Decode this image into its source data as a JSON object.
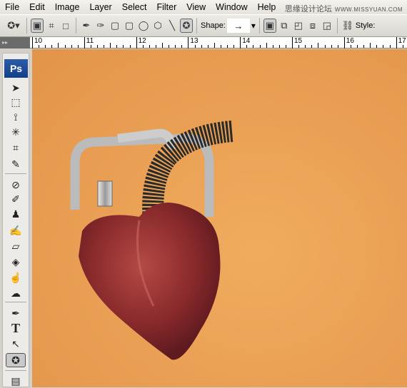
{
  "menubar": {
    "items": [
      "File",
      "Edit",
      "Image",
      "Layer",
      "Select",
      "Filter",
      "View",
      "Window",
      "Help"
    ],
    "watermark": "思缘设计论坛",
    "watermark_url": "WWW.MISSYUAN.COM"
  },
  "options": {
    "shape_label": "Shape:",
    "style_label": "Style:",
    "shape_value": "→"
  },
  "ruler": {
    "labels": [
      "10",
      "11",
      "12",
      "13",
      "14",
      "15",
      "16",
      "17"
    ]
  },
  "toolbox": {
    "logo": "Ps",
    "tools": [
      "move",
      "rectangular-marquee",
      "polygonal-lasso",
      "magic-wand",
      "crop",
      "slice",
      "healing-brush",
      "brush",
      "clone-stamp",
      "history-brush",
      "eraser",
      "paint-bucket",
      "dodge",
      "smudge",
      "pen",
      "type",
      "path-selection",
      "custom-shape",
      "notes"
    ],
    "type_glyph": "T",
    "selected": "custom-shape"
  },
  "colors": {
    "canvas": "#e89d52",
    "accent": "#1c4a96"
  }
}
